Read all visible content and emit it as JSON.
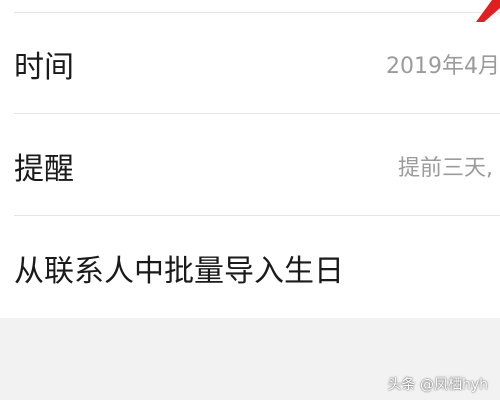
{
  "rows": [
    {
      "label": "时间",
      "value": "2019年4月"
    },
    {
      "label": "提醒",
      "value": "提前三天,"
    },
    {
      "label": "从联系人中批量导入生日"
    }
  ],
  "watermark": "头条 @凤栖hyh",
  "colors": {
    "background": "#f2f2f2",
    "card": "#ffffff",
    "label": "#1a1a1a",
    "value": "#9b9b9b",
    "divider": "#e6e6e6",
    "annotation_arrow": "#e02020"
  },
  "icons": {
    "corner_annotation": "red-arrow-icon"
  }
}
